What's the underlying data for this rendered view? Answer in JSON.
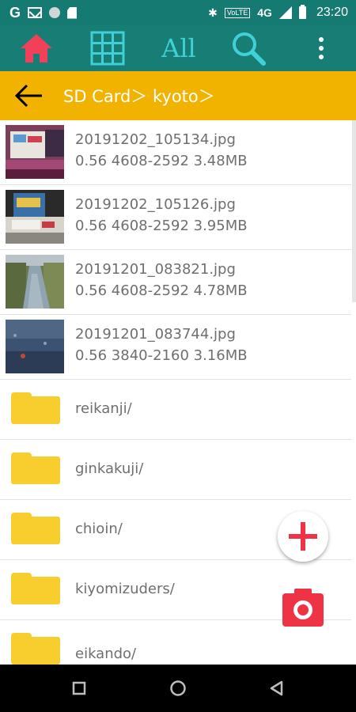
{
  "status_bar": {
    "left_icons": [
      "google-icon",
      "mail-icon",
      "circle-icon",
      "sd-card-icon"
    ],
    "g_label": "G",
    "volte": "VoLTE",
    "network": "4G",
    "network_sup": "4G",
    "time": "23:20"
  },
  "toolbar": {
    "home_icon": "home-icon",
    "grid_icon": "grid-icon",
    "all_label": "All",
    "search_icon": "search-icon",
    "more_icon": "more-vert-icon",
    "colors": {
      "background": "#177d75",
      "home": "#f0405a",
      "accent": "#3fd0d8"
    }
  },
  "path_bar": {
    "back_icon": "back-arrow-icon",
    "path": "SD Card＞ kyoto＞",
    "background": "#f2b300"
  },
  "files": [
    {
      "name": "20191202_105134.jpg",
      "meta": "0.56 4608-2592  3.48MB"
    },
    {
      "name": "20191202_105126.jpg",
      "meta": "0.56 4608-2592  3.95MB"
    },
    {
      "name": "20191201_083821.jpg",
      "meta": "0.56 4608-2592  4.78MB"
    },
    {
      "name": "20191201_083744.jpg",
      "meta": "0.56 3840-2160  3.16MB"
    }
  ],
  "folders": [
    {
      "name": "reikanji/"
    },
    {
      "name": "ginkakuji/"
    },
    {
      "name": "chioin/"
    },
    {
      "name": "kiyomizuders/"
    },
    {
      "name": "eikando/"
    }
  ],
  "fab": {
    "add_icon": "plus-icon",
    "camera_icon": "camera-icon",
    "color": "#ee3344"
  },
  "nav_bar": {
    "recents": "square-icon",
    "home": "circle-icon",
    "back": "triangle-back-icon"
  }
}
